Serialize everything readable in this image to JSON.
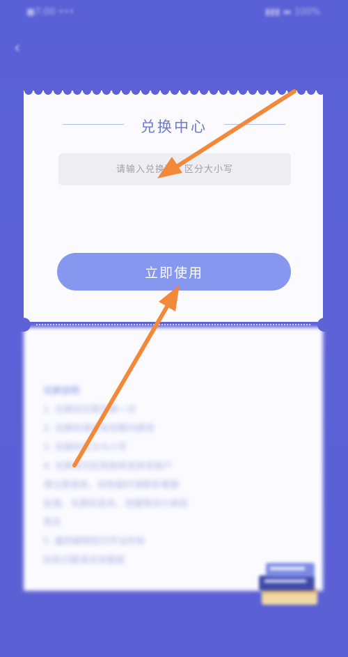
{
  "status_bar": {
    "left_text": "■7:00 ••• ",
    "right_text": "▮▮▮ ▬ 100%"
  },
  "header": {
    "back_symbol": "‹"
  },
  "card": {
    "title": "兑换中心",
    "code_placeholder": "请输入兑换码，区分大小写",
    "use_button_label": "立即使用"
  },
  "rules": {
    "title": "兑换说明",
    "items": [
      "1. 兑换码仅限兑换一次",
      "2. 兑换码请在有效期内使用",
      "3. 兑换码区分大小写",
      "4. 兑换成功后奖励将发放至账户",
      "   请注意查收，如有疑问请联系客服",
      "   处理，兑换码丢失、泄露等自行承担",
      "   责任",
      "5. 最终解释权归平台所有",
      "   如有问题请咨询客服"
    ]
  },
  "annotations": {
    "arrow_color": "#f2893a"
  }
}
